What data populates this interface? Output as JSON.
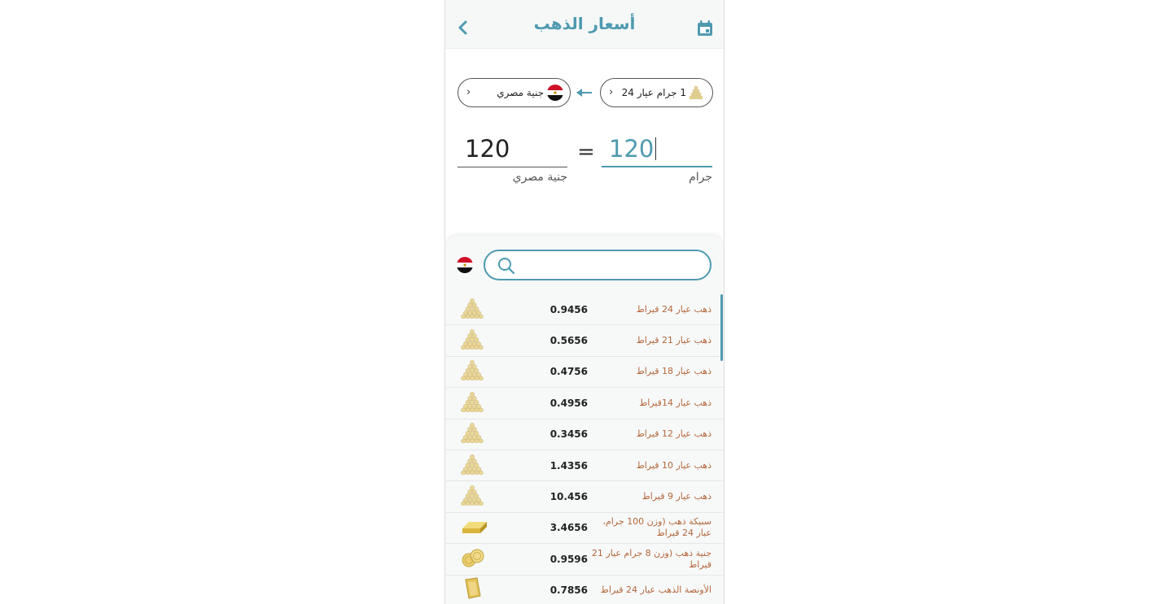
{
  "header": {
    "title": "أسعار الذهب"
  },
  "converter": {
    "from_label": "1 جرام عيار 24",
    "from_chevron": "›",
    "to_label": "جنية مصري",
    "to_chevron": "›",
    "equals": "=",
    "input_value": "120",
    "output_value": "120",
    "input_unit": "جرام",
    "output_unit": "جنية مصري"
  },
  "search": {
    "placeholder": ""
  },
  "colors": {
    "accent": "#4e9ab0",
    "item_name": "#b4663a",
    "gold": "#e6cf8a"
  },
  "items": [
    {
      "name": "ذهب عيار 24 قيراط",
      "value": "0.9456",
      "icon": "gold-pile-icon"
    },
    {
      "name": "ذهب عيار 21 قيراط",
      "value": "0.5656",
      "icon": "gold-pile-icon"
    },
    {
      "name": "ذهب عيار  18 قيراط",
      "value": "0.4756",
      "icon": "gold-pile-icon"
    },
    {
      "name": "ذهب عيار 14قيراط",
      "value": "0.4956",
      "icon": "gold-pile-icon"
    },
    {
      "name": "ذهب عيار 12 قيراط",
      "value": "0.3456",
      "icon": "gold-pile-icon"
    },
    {
      "name": "ذهب عيار 10 قيراط",
      "value": "1.4356",
      "icon": "gold-pile-icon"
    },
    {
      "name": "ذهب عيار 9 قيراط",
      "value": "10.456",
      "icon": "gold-pile-icon"
    },
    {
      "name": "سبيكة ذهب (وزن 100 جرام، عيار 24 قيراط",
      "value": "3.4656",
      "icon": "gold-bar-icon"
    },
    {
      "name": "جنية ذهب (وزن 8 جرام عيار 21 قيراط",
      "value": "0.9596",
      "icon": "gold-coins-icon"
    },
    {
      "name": "الأونصة الذهب عيار 24 قيراط",
      "value": "0.7856",
      "icon": "gold-ounce-icon"
    }
  ]
}
